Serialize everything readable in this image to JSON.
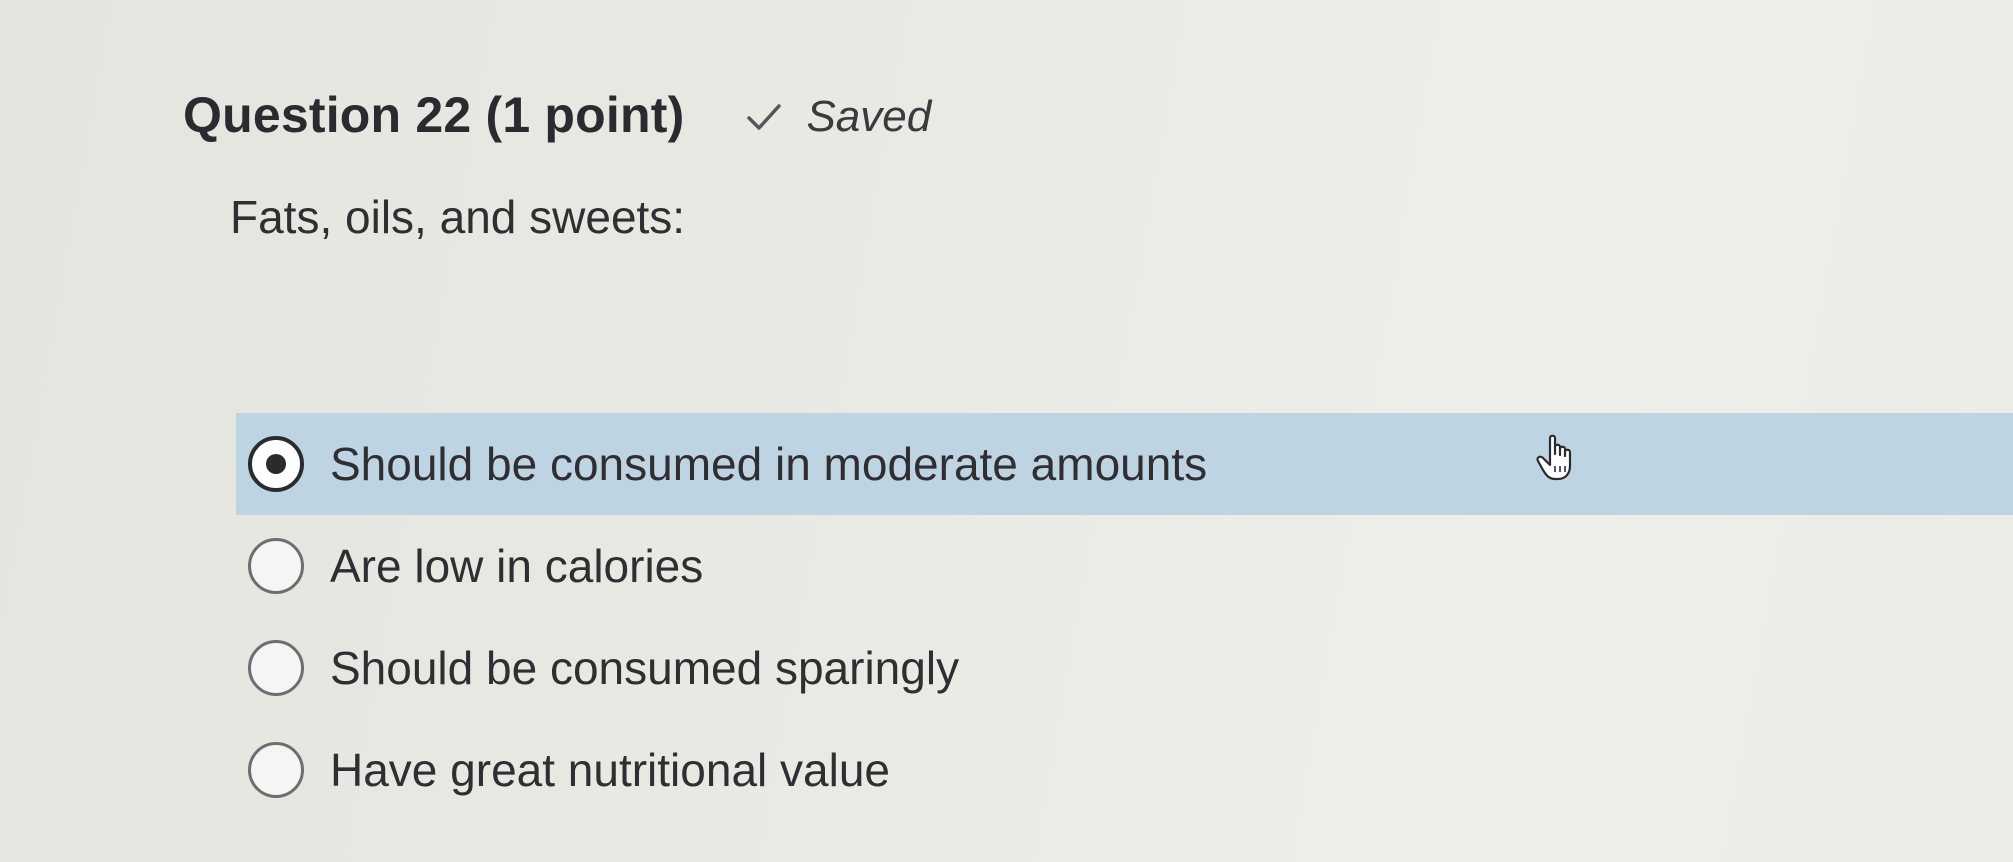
{
  "question": {
    "title": "Question 22 (1 point)",
    "status": "Saved",
    "status_icon": "check-icon",
    "prompt": "Fats, oils, and sweets:"
  },
  "options": [
    {
      "label": "Should be consumed in moderate amounts",
      "selected": true
    },
    {
      "label": "Are low in calories",
      "selected": false
    },
    {
      "label": "Should be consumed sparingly",
      "selected": false
    },
    {
      "label": "Have great nutritional value",
      "selected": false
    }
  ],
  "colors": {
    "selected_highlight": "#bfd4e3",
    "text": "#2f2f33",
    "background": "#eae9e4"
  },
  "cursor": "hand-pointer-icon"
}
